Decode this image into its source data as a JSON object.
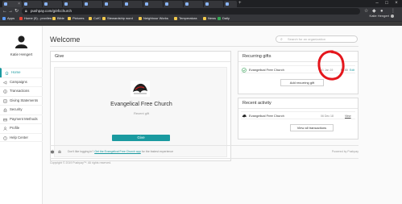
{
  "browser": {
    "url": "pushpay.com/g/efcchurch",
    "bookmarks": [
      "Apps",
      "Home (5) - proviles",
      "Bible",
      "Pictures",
      "CofC",
      "Stewardship word",
      "Neighbour Works",
      "Temperatura",
      "News",
      "Daily"
    ]
  },
  "header": {
    "user_name": "Katie Hengert"
  },
  "sidebar": {
    "profile_name": "Katie Hengert",
    "items": [
      {
        "label": "Home",
        "icon": "home-icon",
        "active": true
      },
      {
        "label": "Campaigns",
        "icon": "megaphone-icon",
        "active": false
      },
      {
        "label": "Transactions",
        "icon": "dollar-icon",
        "active": false
      },
      {
        "label": "Giving Statements",
        "icon": "document-icon",
        "active": false
      },
      {
        "label": "Security",
        "icon": "lock-icon",
        "active": false
      },
      {
        "label": "Payment Methods",
        "icon": "card-icon",
        "active": false
      },
      {
        "label": "Profile",
        "icon": "person-icon",
        "active": false
      },
      {
        "label": "Help Center",
        "icon": "help-icon",
        "active": false
      }
    ]
  },
  "main": {
    "title": "Welcome",
    "search_placeholder": "Search for an organization"
  },
  "give": {
    "title": "Give",
    "church_name": "Evangelical Free Church",
    "recent_gift": "Recent gift",
    "button": "Give"
  },
  "recurring": {
    "title": "Recurring gifts",
    "row": {
      "church": "Evangelical Free Church",
      "date": "01 Jan 19",
      "amount": "$0.00",
      "edit": "Edit"
    },
    "add_button": "Add recurring gift"
  },
  "activity": {
    "title": "Recent activity",
    "row": {
      "church": "Evangelical Free Church",
      "date": "06 Dec 18",
      "view": "View"
    },
    "all_button": "View all transactions"
  },
  "footer": {
    "apps_text": "Don't like logging in?",
    "apps_link": "Get the Evangelical Free Church app",
    "apps_suffix": "for the fastest experience",
    "powered_by": "Powered by Pushpay",
    "copyright": "Copyright © 2019 Pushpay™. All rights reserved."
  },
  "colors": {
    "accent": "#1a9aa0",
    "annotation": "#e4161c",
    "header_dark": "#3a3a3a"
  }
}
